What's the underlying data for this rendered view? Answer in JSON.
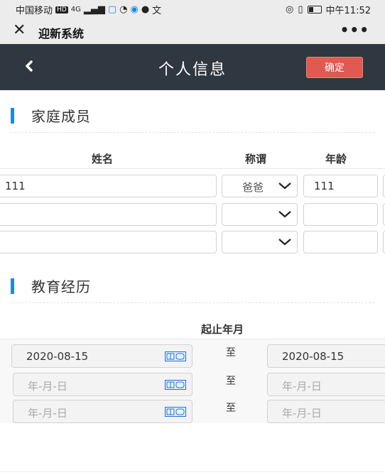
{
  "statusbar": {
    "carrier": "中国移动",
    "hd": "HD",
    "network": "4G",
    "time_label": "中午11:52"
  },
  "wechat": {
    "close": "✕",
    "title": "迎新系统",
    "more": "•••"
  },
  "header": {
    "title": "个人信息",
    "confirm": "确定"
  },
  "family": {
    "section_title": "家庭成员",
    "columns": {
      "name": "姓名",
      "relation": "称谓",
      "age": "年龄"
    },
    "rows": [
      {
        "name": "111",
        "relation": "爸爸",
        "age": "111"
      },
      {
        "name": "",
        "relation": "",
        "age": ""
      },
      {
        "name": "",
        "relation": "",
        "age": ""
      }
    ]
  },
  "education": {
    "section_title": "教育经历",
    "column": "起止年月",
    "separator": "至",
    "placeholder": "年-月-日",
    "rows": [
      {
        "start": "2020-08-15",
        "end": "2020-08-15"
      },
      {
        "start": "",
        "end": ""
      },
      {
        "start": "",
        "end": ""
      }
    ]
  },
  "colors": {
    "header_bg": "#2f3740",
    "confirm_bg": "#e05a52",
    "accent_bar": "#1e88e5"
  }
}
